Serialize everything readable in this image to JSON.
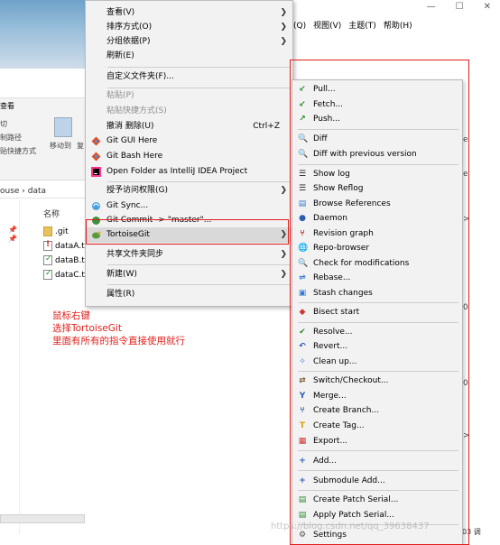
{
  "explorer": {
    "menubar": [
      "式(Q)",
      "视图(V)",
      "主题(T)",
      "帮助(H)"
    ],
    "view_label": "查看",
    "ribbon_cut": "切",
    "ribbon_copy_path": "制路径",
    "ribbon_paste_shortcut": "贴快捷方式",
    "ribbon_move_to": "移动到",
    "ribbon_copy": "复",
    "address": "ouse  ›  data",
    "column_name": "名称",
    "files": [
      ".git",
      "dataA.t",
      "dataB.t",
      "dataC.t"
    ],
    "status_right": "03 调",
    "right_edge_chars": [
      "e",
      "e",
      ">",
      "0",
      "0",
      ">"
    ]
  },
  "annotation": [
    "鼠标右键",
    "选择TortoiseGit",
    "里面有所有的指令直接使用就行"
  ],
  "watermark": "https://blog.csdn.net/qq_39638437",
  "context_menu": {
    "view": "查看(V)",
    "sort": "排序方式(O)",
    "group": "分组依据(P)",
    "refresh": "刷新(E)",
    "customize": "自定义文件夹(F)...",
    "paste": "粘贴(P)",
    "paste_shortcut": "粘贴快捷方式(S)",
    "undo_delete": "撤消 删除(U)",
    "undo_shortcut": "Ctrl+Z",
    "git_gui": "Git GUI Here",
    "git_bash": "Git Bash Here",
    "intellij": "Open Folder as IntelliJ IDEA Project",
    "grant_access": "授予访问权限(G)",
    "git_sync": "Git Sync...",
    "git_commit": "Git Commit -> \"master\"...",
    "tortoisegit": "TortoiseGit",
    "share_sync": "共享文件夹同步",
    "new": "新建(W)",
    "properties": "属性(R)"
  },
  "tortoise_menu": {
    "pull": "Pull...",
    "fetch": "Fetch...",
    "push": "Push...",
    "diff": "Diff",
    "diff_prev": "Diff with previous version",
    "show_log": "Show log",
    "show_reflog": "Show Reflog",
    "browse_refs": "Browse References",
    "daemon": "Daemon",
    "revision_graph": "Revision graph",
    "repo_browser": "Repo-browser",
    "check_mods": "Check for modifications",
    "rebase": "Rebase...",
    "stash": "Stash changes",
    "bisect": "Bisect start",
    "resolve": "Resolve...",
    "revert": "Revert...",
    "cleanup": "Clean up...",
    "switch": "Switch/Checkout...",
    "merge": "Merge...",
    "create_branch": "Create Branch...",
    "create_tag": "Create Tag...",
    "export": "Export...",
    "add": "Add...",
    "submodule_add": "Submodule Add...",
    "create_patch": "Create Patch Serial...",
    "apply_patch": "Apply Patch Serial...",
    "settings": "Settings"
  },
  "colors": {
    "highlight_red": "#e0201c",
    "menu_bg": "#f2f2f2",
    "disabled_text": "#8d8d8d"
  }
}
